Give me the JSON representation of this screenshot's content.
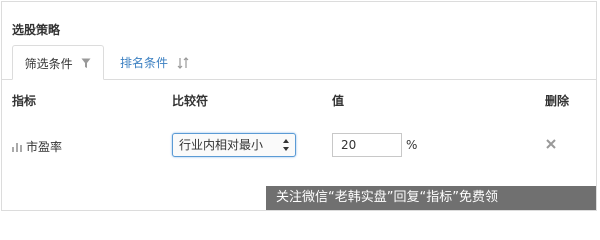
{
  "panel": {
    "title": "选股策略"
  },
  "tabs": [
    {
      "label": "筛选条件",
      "icon": "filter-icon",
      "active": true
    },
    {
      "label": "排名条件",
      "icon": "sort-icon",
      "active": false
    }
  ],
  "table": {
    "headers": {
      "indicator": "指标",
      "comparator": "比较符",
      "value": "值",
      "delete": "删除"
    },
    "rows": [
      {
        "indicator": "市盈率",
        "icon": "bar-chart-icon",
        "comparator": "行业内相对最小",
        "value": "20",
        "unit": "%",
        "delete_icon": "close-icon"
      }
    ]
  },
  "watermark": {
    "text": "关注微信“老韩实盘”回复“指标”免费领"
  },
  "colors": {
    "link": "#3a7fc1",
    "border": "#dcdcdc",
    "select_focus": "#5b9bd5"
  }
}
